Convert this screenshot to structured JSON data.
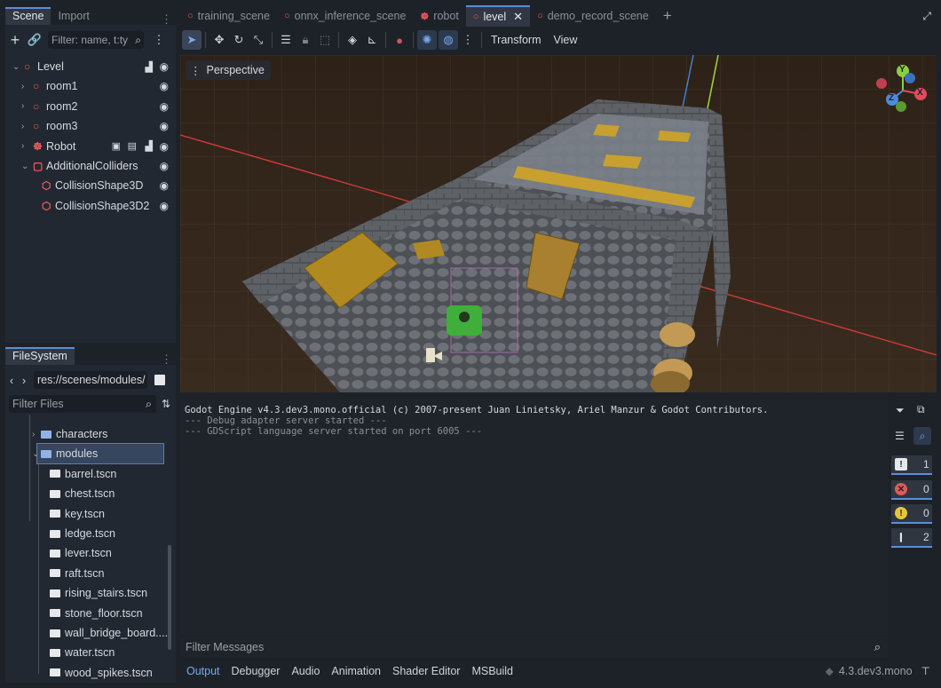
{
  "scene_dock": {
    "tabs": [
      "Scene",
      "Import"
    ],
    "filter_placeholder": "Filter: name, t:ty",
    "tree": [
      {
        "label": "Level",
        "indent": 0,
        "icon": "node3d-icon",
        "expander": "collapse"
      },
      {
        "label": "room1",
        "indent": 1,
        "icon": "node3d-icon",
        "expander": "expand"
      },
      {
        "label": "room2",
        "indent": 1,
        "icon": "node3d-icon",
        "expander": "expand"
      },
      {
        "label": "room3",
        "indent": 1,
        "icon": "node3d-icon",
        "expander": "expand"
      },
      {
        "label": "Robot",
        "indent": 1,
        "icon": "robot-icon",
        "expander": "expand"
      },
      {
        "label": "AdditionalColliders",
        "indent": 1,
        "icon": "static-body-icon",
        "expander": "collapse"
      },
      {
        "label": "CollisionShape3D",
        "indent": 2,
        "icon": "collision-shape-icon",
        "expander": ""
      },
      {
        "label": "CollisionShape3D2",
        "indent": 2,
        "icon": "collision-shape-icon",
        "expander": ""
      }
    ]
  },
  "filesystem": {
    "tab": "FileSystem",
    "path": "res://scenes/modules/",
    "filter_placeholder": "Filter Files",
    "items": [
      {
        "label": "characters",
        "type": "folder",
        "indent": 1,
        "selected": false
      },
      {
        "label": "modules",
        "type": "folder",
        "indent": 1,
        "selected": true
      },
      {
        "label": "barrel.tscn",
        "type": "scene",
        "indent": 2,
        "selected": false
      },
      {
        "label": "chest.tscn",
        "type": "scene",
        "indent": 2,
        "selected": false
      },
      {
        "label": "key.tscn",
        "type": "scene",
        "indent": 2,
        "selected": false
      },
      {
        "label": "ledge.tscn",
        "type": "scene",
        "indent": 2,
        "selected": false
      },
      {
        "label": "lever.tscn",
        "type": "scene",
        "indent": 2,
        "selected": false
      },
      {
        "label": "raft.tscn",
        "type": "scene",
        "indent": 2,
        "selected": false
      },
      {
        "label": "rising_stairs.tscn",
        "type": "scene",
        "indent": 2,
        "selected": false
      },
      {
        "label": "stone_floor.tscn",
        "type": "scene",
        "indent": 2,
        "selected": false
      },
      {
        "label": "wall_bridge_board....",
        "type": "scene",
        "indent": 2,
        "selected": false
      },
      {
        "label": "water.tscn",
        "type": "scene",
        "indent": 2,
        "selected": false
      },
      {
        "label": "wood_spikes.tscn",
        "type": "scene",
        "indent": 2,
        "selected": false
      }
    ]
  },
  "editor_tabs": [
    {
      "label": "training_scene",
      "icon": "node3d-icon",
      "active": false
    },
    {
      "label": "onnx_inference_scene",
      "icon": "node3d-icon",
      "active": false
    },
    {
      "label": "robot",
      "icon": "robot-icon",
      "active": false
    },
    {
      "label": "level",
      "icon": "node3d-icon",
      "active": true
    },
    {
      "label": "demo_record_scene",
      "icon": "node3d-icon",
      "active": false
    }
  ],
  "toolbar": {
    "transform_menu": "Transform",
    "view_menu": "View"
  },
  "viewport": {
    "perspective_label": "Perspective",
    "gizmo": {
      "y": "Y",
      "x": "X",
      "z": "Z"
    }
  },
  "output": {
    "lines": [
      "Godot Engine v4.3.dev3.mono.official (c) 2007-present Juan Linietsky, Ariel Manzur & Godot Contributors.",
      "--- Debug adapter server started ---",
      "--- GDScript language server started on port 6005 ---"
    ],
    "filter_placeholder": "Filter Messages",
    "counts": {
      "log": "1",
      "errors": "0",
      "warnings": "0",
      "messages": "2"
    }
  },
  "bottom_tabs": [
    "Output",
    "Debugger",
    "Audio",
    "Animation",
    "Shader Editor",
    "MSBuild"
  ],
  "version": "4.3.dev3.mono",
  "colors": {
    "accent": "#5a8fd6",
    "node": "#f05a5a",
    "folder": "#8fb3e6"
  }
}
